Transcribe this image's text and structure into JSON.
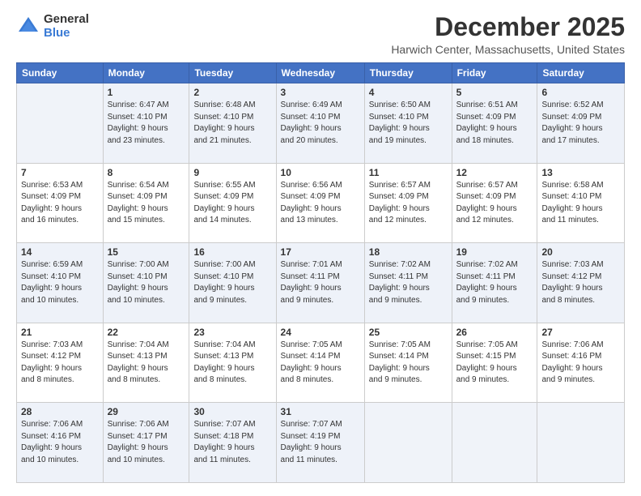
{
  "logo": {
    "general": "General",
    "blue": "Blue"
  },
  "title": "December 2025",
  "subtitle": "Harwich Center, Massachusetts, United States",
  "calendar": {
    "headers": [
      "Sunday",
      "Monday",
      "Tuesday",
      "Wednesday",
      "Thursday",
      "Friday",
      "Saturday"
    ],
    "weeks": [
      [
        {
          "day": "",
          "info": ""
        },
        {
          "day": "1",
          "info": "Sunrise: 6:47 AM\nSunset: 4:10 PM\nDaylight: 9 hours\nand 23 minutes."
        },
        {
          "day": "2",
          "info": "Sunrise: 6:48 AM\nSunset: 4:10 PM\nDaylight: 9 hours\nand 21 minutes."
        },
        {
          "day": "3",
          "info": "Sunrise: 6:49 AM\nSunset: 4:10 PM\nDaylight: 9 hours\nand 20 minutes."
        },
        {
          "day": "4",
          "info": "Sunrise: 6:50 AM\nSunset: 4:10 PM\nDaylight: 9 hours\nand 19 minutes."
        },
        {
          "day": "5",
          "info": "Sunrise: 6:51 AM\nSunset: 4:09 PM\nDaylight: 9 hours\nand 18 minutes."
        },
        {
          "day": "6",
          "info": "Sunrise: 6:52 AM\nSunset: 4:09 PM\nDaylight: 9 hours\nand 17 minutes."
        }
      ],
      [
        {
          "day": "7",
          "info": "Sunrise: 6:53 AM\nSunset: 4:09 PM\nDaylight: 9 hours\nand 16 minutes."
        },
        {
          "day": "8",
          "info": "Sunrise: 6:54 AM\nSunset: 4:09 PM\nDaylight: 9 hours\nand 15 minutes."
        },
        {
          "day": "9",
          "info": "Sunrise: 6:55 AM\nSunset: 4:09 PM\nDaylight: 9 hours\nand 14 minutes."
        },
        {
          "day": "10",
          "info": "Sunrise: 6:56 AM\nSunset: 4:09 PM\nDaylight: 9 hours\nand 13 minutes."
        },
        {
          "day": "11",
          "info": "Sunrise: 6:57 AM\nSunset: 4:09 PM\nDaylight: 9 hours\nand 12 minutes."
        },
        {
          "day": "12",
          "info": "Sunrise: 6:57 AM\nSunset: 4:09 PM\nDaylight: 9 hours\nand 12 minutes."
        },
        {
          "day": "13",
          "info": "Sunrise: 6:58 AM\nSunset: 4:10 PM\nDaylight: 9 hours\nand 11 minutes."
        }
      ],
      [
        {
          "day": "14",
          "info": "Sunrise: 6:59 AM\nSunset: 4:10 PM\nDaylight: 9 hours\nand 10 minutes."
        },
        {
          "day": "15",
          "info": "Sunrise: 7:00 AM\nSunset: 4:10 PM\nDaylight: 9 hours\nand 10 minutes."
        },
        {
          "day": "16",
          "info": "Sunrise: 7:00 AM\nSunset: 4:10 PM\nDaylight: 9 hours\nand 9 minutes."
        },
        {
          "day": "17",
          "info": "Sunrise: 7:01 AM\nSunset: 4:11 PM\nDaylight: 9 hours\nand 9 minutes."
        },
        {
          "day": "18",
          "info": "Sunrise: 7:02 AM\nSunset: 4:11 PM\nDaylight: 9 hours\nand 9 minutes."
        },
        {
          "day": "19",
          "info": "Sunrise: 7:02 AM\nSunset: 4:11 PM\nDaylight: 9 hours\nand 9 minutes."
        },
        {
          "day": "20",
          "info": "Sunrise: 7:03 AM\nSunset: 4:12 PM\nDaylight: 9 hours\nand 8 minutes."
        }
      ],
      [
        {
          "day": "21",
          "info": "Sunrise: 7:03 AM\nSunset: 4:12 PM\nDaylight: 9 hours\nand 8 minutes."
        },
        {
          "day": "22",
          "info": "Sunrise: 7:04 AM\nSunset: 4:13 PM\nDaylight: 9 hours\nand 8 minutes."
        },
        {
          "day": "23",
          "info": "Sunrise: 7:04 AM\nSunset: 4:13 PM\nDaylight: 9 hours\nand 8 minutes."
        },
        {
          "day": "24",
          "info": "Sunrise: 7:05 AM\nSunset: 4:14 PM\nDaylight: 9 hours\nand 8 minutes."
        },
        {
          "day": "25",
          "info": "Sunrise: 7:05 AM\nSunset: 4:14 PM\nDaylight: 9 hours\nand 9 minutes."
        },
        {
          "day": "26",
          "info": "Sunrise: 7:05 AM\nSunset: 4:15 PM\nDaylight: 9 hours\nand 9 minutes."
        },
        {
          "day": "27",
          "info": "Sunrise: 7:06 AM\nSunset: 4:16 PM\nDaylight: 9 hours\nand 9 minutes."
        }
      ],
      [
        {
          "day": "28",
          "info": "Sunrise: 7:06 AM\nSunset: 4:16 PM\nDaylight: 9 hours\nand 10 minutes."
        },
        {
          "day": "29",
          "info": "Sunrise: 7:06 AM\nSunset: 4:17 PM\nDaylight: 9 hours\nand 10 minutes."
        },
        {
          "day": "30",
          "info": "Sunrise: 7:07 AM\nSunset: 4:18 PM\nDaylight: 9 hours\nand 11 minutes."
        },
        {
          "day": "31",
          "info": "Sunrise: 7:07 AM\nSunset: 4:19 PM\nDaylight: 9 hours\nand 11 minutes."
        },
        {
          "day": "",
          "info": ""
        },
        {
          "day": "",
          "info": ""
        },
        {
          "day": "",
          "info": ""
        }
      ]
    ]
  }
}
